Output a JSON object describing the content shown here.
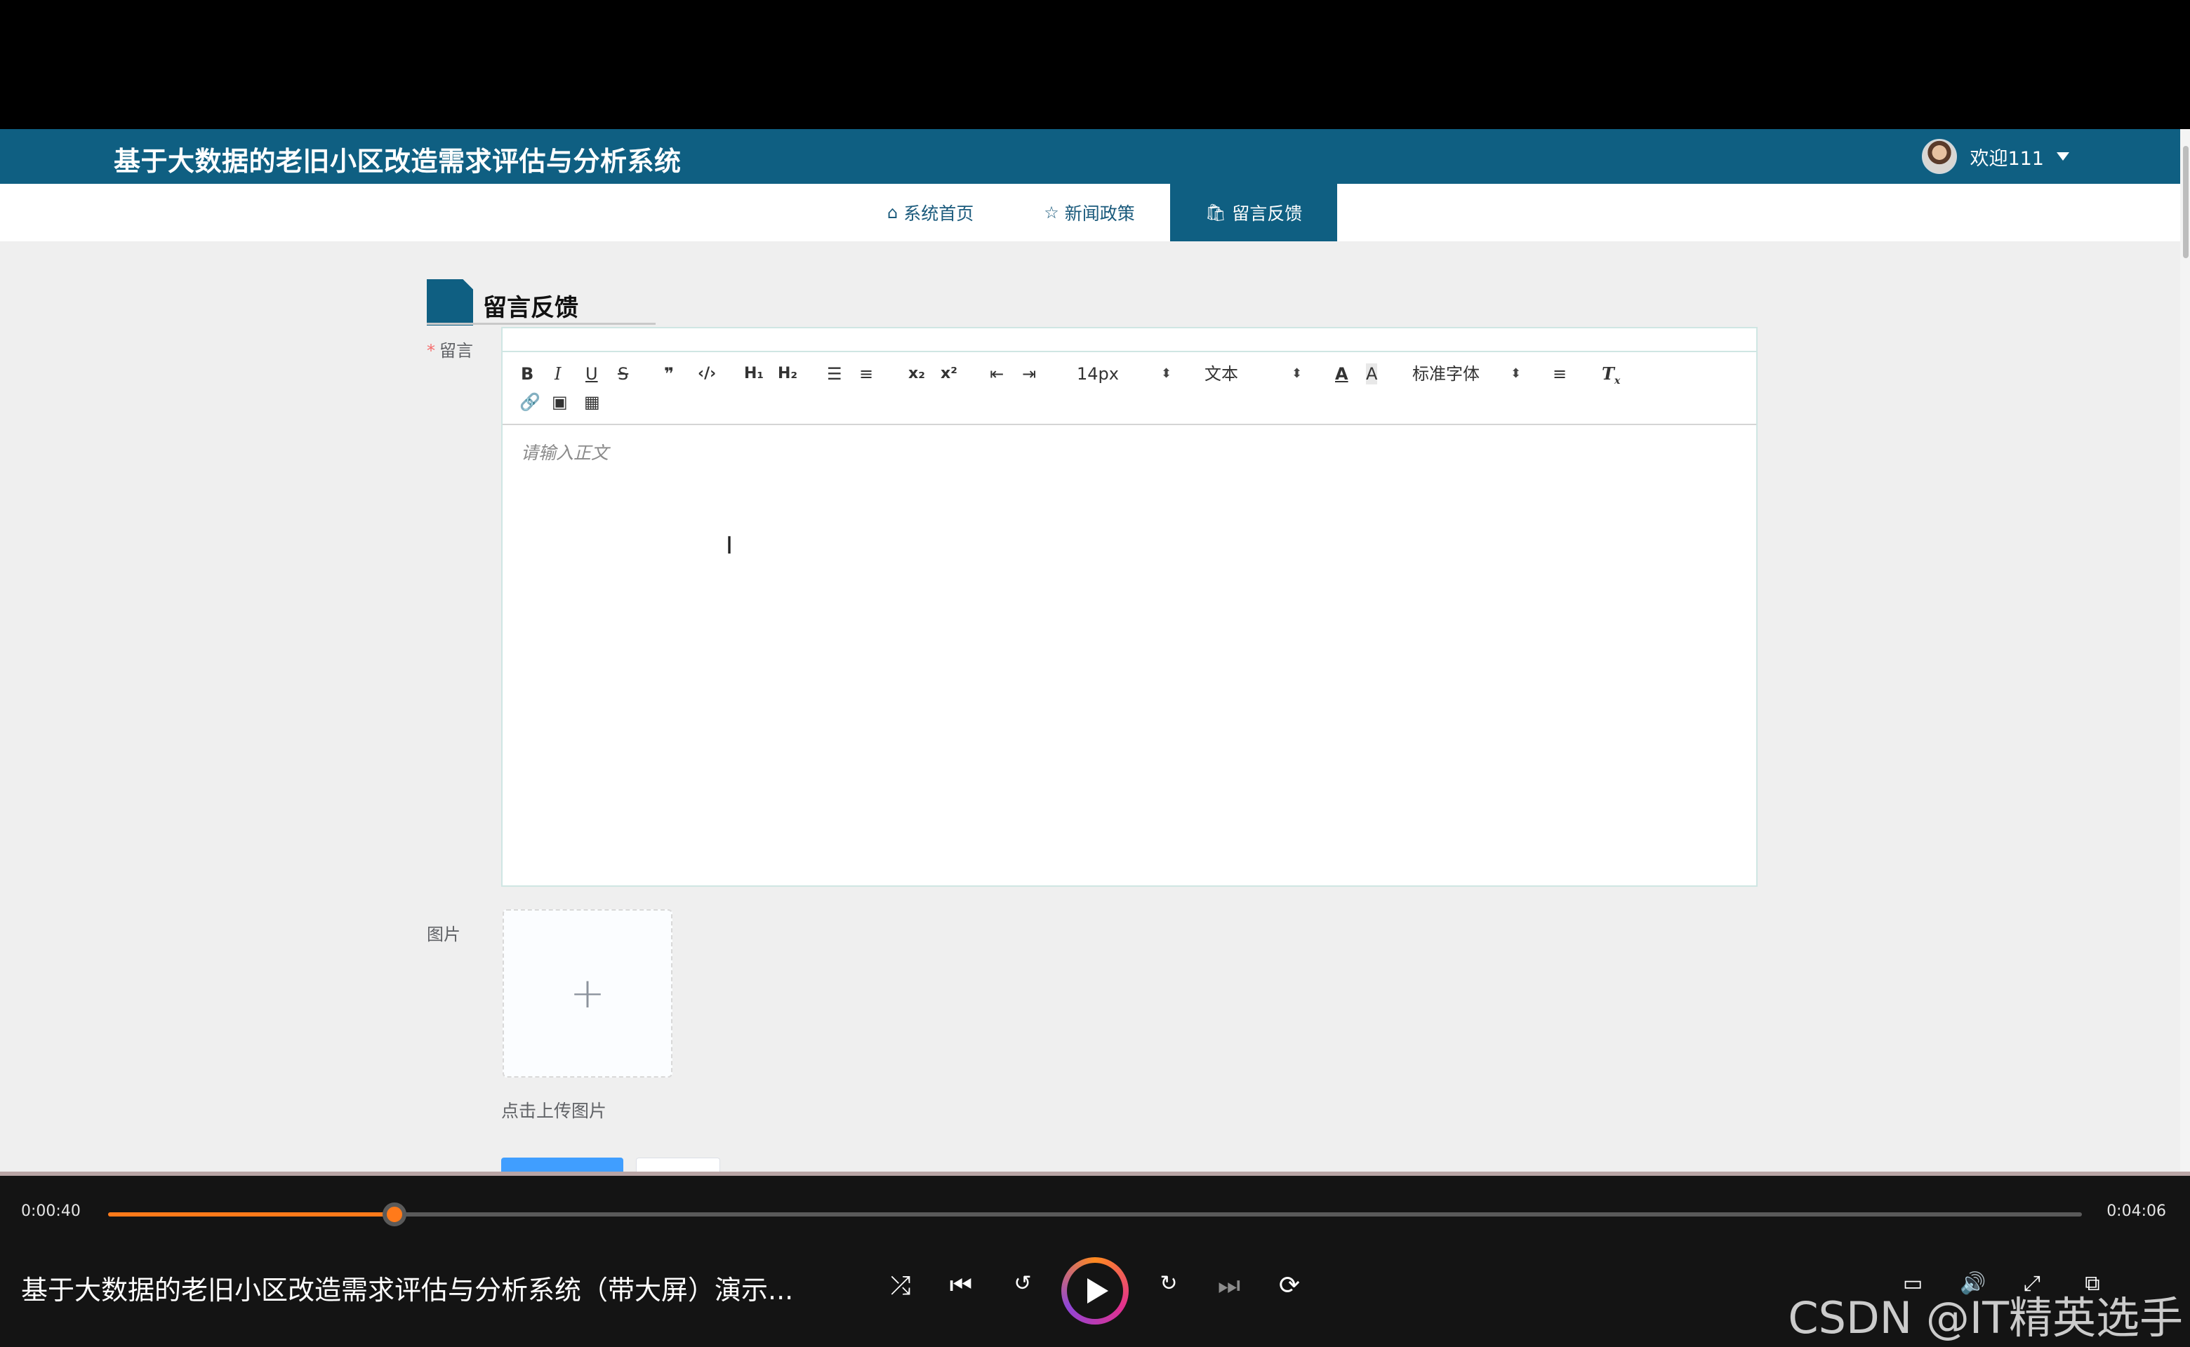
{
  "site": {
    "title": "基于大数据的老旧小区改造需求评估与分析系统",
    "user": {
      "welcome": "欢迎111"
    },
    "nav": [
      {
        "icon": "home-icon",
        "glyph": "⌂",
        "label": "系统首页",
        "active": false
      },
      {
        "icon": "star-icon",
        "glyph": "☆",
        "label": "新闻政策",
        "active": false
      },
      {
        "icon": "bag-icon",
        "glyph": "🛍",
        "label": "留言反馈",
        "active": true
      }
    ],
    "accent_color": "#0f5f82"
  },
  "form": {
    "section_title": "留言反馈",
    "message_label": "留言",
    "required_mark": "*",
    "editor": {
      "font_size": "14px",
      "paragraph_type": "文本",
      "font_family": "标准字体",
      "placeholder": "请输入正文"
    },
    "image_label": "图片",
    "upload_hint": "点击上传图片"
  },
  "player": {
    "current_time": "0:00:40",
    "total_time": "0:04:06",
    "progress": 0.145,
    "title": "基于大数据的老旧小区改造需求评估与分析系统（带大屏）演示...",
    "watermark": "CSDN @IT精英选手",
    "accent_color": "#ff7a1a"
  }
}
